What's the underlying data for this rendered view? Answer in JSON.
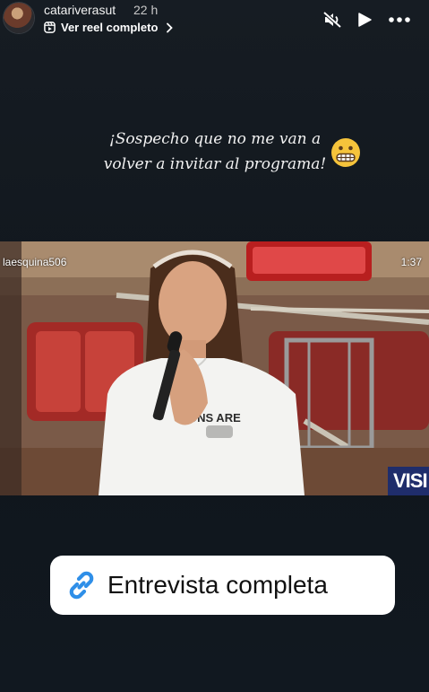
{
  "header": {
    "username": "catariverasut",
    "time_ago": "22 h",
    "reel_link_label": "Ver reel completo"
  },
  "icons": {
    "avatar": "profile-avatar",
    "reel": "reel-icon",
    "chevron": "chevron-right-icon",
    "mute": "mute-icon",
    "play": "play-icon",
    "more": "more-icon",
    "emoji": "grimacing-face-emoji",
    "link": "link-icon"
  },
  "caption": {
    "text": "¡Sospecho que no me van a\nvolver a invitar al programa!"
  },
  "video": {
    "credit": "laesquina506",
    "duration": "1:37",
    "watermark": "VISI",
    "shirt_text": "ONS ARE"
  },
  "link_sticker": {
    "label": "Entrevista completa"
  },
  "colors": {
    "background": "#131920",
    "sticker_bg": "#ffffff",
    "link_icon": "#2f8fe8"
  }
}
